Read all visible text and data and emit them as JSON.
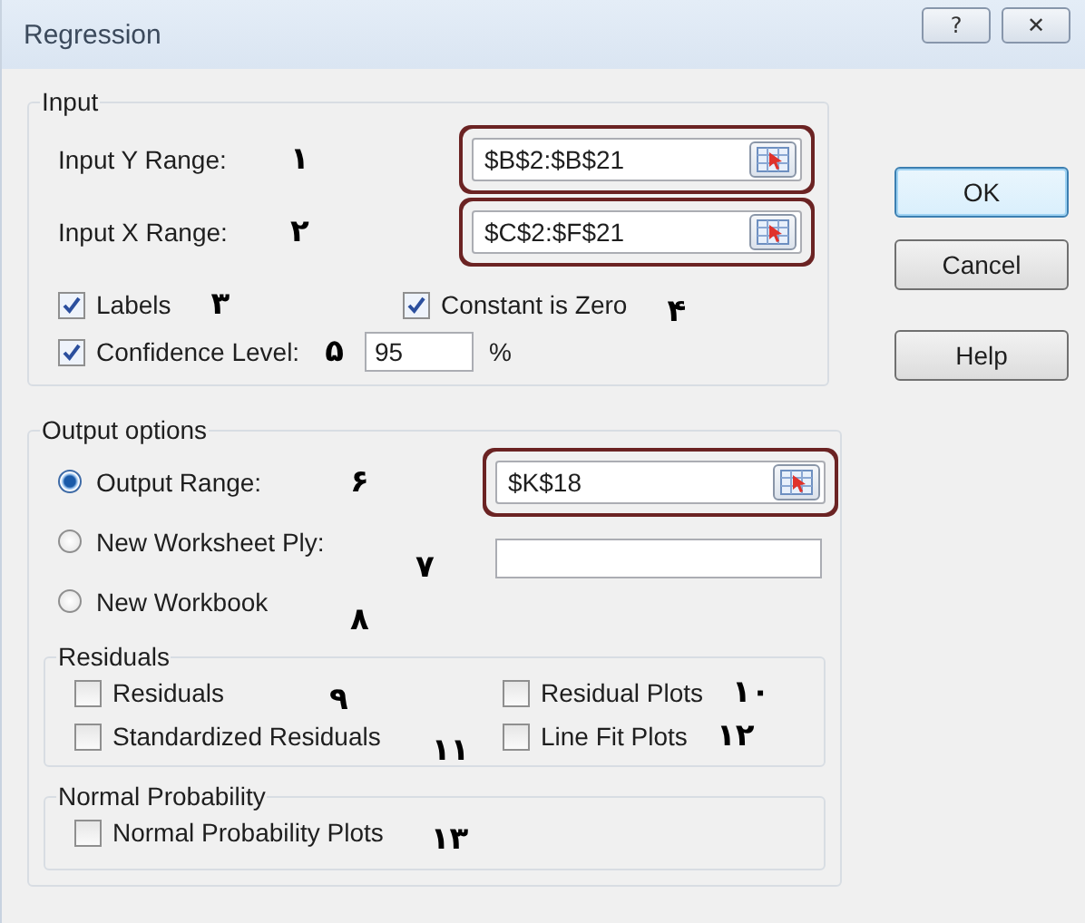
{
  "window": {
    "title": "Regression",
    "title_buttons": [
      "?",
      "✕"
    ]
  },
  "input": {
    "title": "Input",
    "ranges": [
      {
        "label": "Input Y Range:",
        "note": "۱",
        "value": "$B$2:$B$21",
        "highlighted": true
      },
      {
        "label": "Input X Range:",
        "note": "۲",
        "value": "$C$2:$F$21",
        "highlighted": true
      }
    ],
    "labels_option": {
      "label": "Labels",
      "checked": true,
      "note": "۳"
    },
    "constant_option": {
      "label": "Constant is Zero",
      "checked": true,
      "note": "۴"
    },
    "confidence": {
      "label": "Confidence Level:",
      "checked": true,
      "note": "۵",
      "value": "95",
      "unit": "%"
    }
  },
  "output": {
    "title": "Output options",
    "choices": [
      {
        "label": "Output Range:",
        "selected": true,
        "note": "۶",
        "kind": "range",
        "value": "$K$18",
        "highlighted": true
      },
      {
        "label": "New Worksheet Ply:",
        "selected": false,
        "note": "۷",
        "kind": "text",
        "highlighted": false
      },
      {
        "label": "New Workbook",
        "selected": false,
        "note": "۸",
        "kind": "none"
      }
    ],
    "residuals": {
      "title": "Residuals",
      "items": [
        {
          "label": "Residuals",
          "checked": false,
          "note": "۹"
        },
        {
          "label": "Residual Plots",
          "checked": false,
          "note": "۱۰"
        },
        {
          "label": "Standardized Residuals",
          "checked": false,
          "note": "۱۱"
        },
        {
          "label": "Line Fit Plots",
          "checked": false,
          "note": "۱۲"
        }
      ]
    },
    "normal": {
      "title": "Normal Probability",
      "items": [
        {
          "label": "Normal Probability Plots",
          "checked": false,
          "note": "۱۳"
        }
      ]
    }
  },
  "buttons": [
    {
      "label": "OK",
      "default": true
    },
    {
      "label": "Cancel",
      "default": false
    },
    {
      "label": "Help",
      "default": false
    }
  ]
}
